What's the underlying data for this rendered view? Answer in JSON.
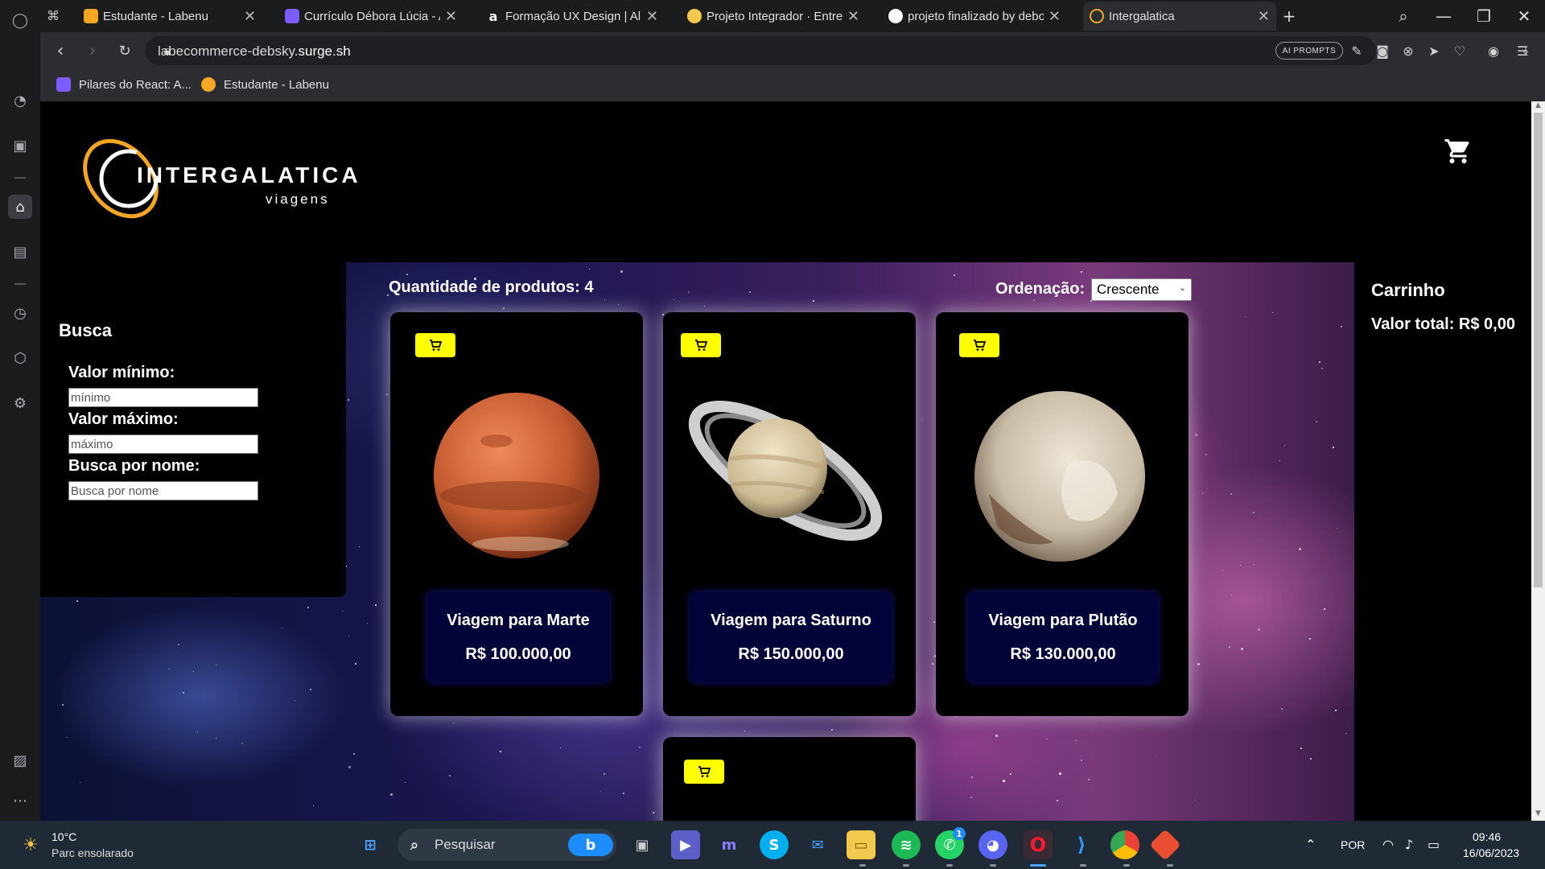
{
  "browser": {
    "tabs": [
      {
        "title": "Estudante - Labenu",
        "favicon": "labenu-icon",
        "active": false
      },
      {
        "title": "Currículo Débora Lúcia - Ad",
        "favicon": "canva-icon",
        "active": false
      },
      {
        "title": "Formação UX Design | Alun",
        "favicon": "alura-icon",
        "active": false
      },
      {
        "title": "Projeto Integrador · Entreg",
        "favicon": "chrome-icon",
        "active": false
      },
      {
        "title": "projeto finalizado by debor",
        "favicon": "github-icon",
        "active": false
      },
      {
        "title": "Intergalatica",
        "favicon": "intergalatica-icon",
        "active": true
      }
    ],
    "url_prefix": "labecommerce-debsky.",
    "url_domain": "surge.sh",
    "ai_prompts_label": "AI PROMPTS",
    "bookmarks": [
      {
        "label": "Pilares do React: A...",
        "favicon": "react-icon"
      },
      {
        "label": "Estudante - Labenu",
        "favicon": "labenu-icon"
      }
    ]
  },
  "site": {
    "logo_brand": "INTERGALATICA",
    "logo_sub": "viagens",
    "filters": {
      "title": "Busca",
      "min_label": "Valor mínimo:",
      "min_placeholder": "mínimo",
      "max_label": "Valor máximo:",
      "max_placeholder": "máximo",
      "name_label": "Busca por nome:",
      "name_placeholder": "Busca por nome"
    },
    "product_count_label": "Quantidade de produtos: 4",
    "sort_label": "Ordenação:",
    "sort_value": "Crescente",
    "products": [
      {
        "name": "Viagem para Marte",
        "price": "R$ 100.000,00",
        "planet": "mars"
      },
      {
        "name": "Viagem para Saturno",
        "price": "R$ 150.000,00",
        "planet": "saturn"
      },
      {
        "name": "Viagem para Plutão",
        "price": "R$ 130.000,00",
        "planet": "pluto"
      },
      {
        "name": "",
        "price": "",
        "planet": ""
      }
    ],
    "cart": {
      "title": "Carrinho",
      "total_label": "Valor total: R$ 0,00"
    }
  },
  "taskbar": {
    "weather_temp": "10°C",
    "weather_desc": "Parc ensolarado",
    "search_label": "Pesquisar",
    "language": "POR",
    "time": "09:46",
    "date": "16/06/2023",
    "whatsapp_badge": "1"
  },
  "colors": {
    "accent_yellow": "#ffff00",
    "logo_orange": "#f5a623",
    "card_info_bg": "#03033a"
  }
}
